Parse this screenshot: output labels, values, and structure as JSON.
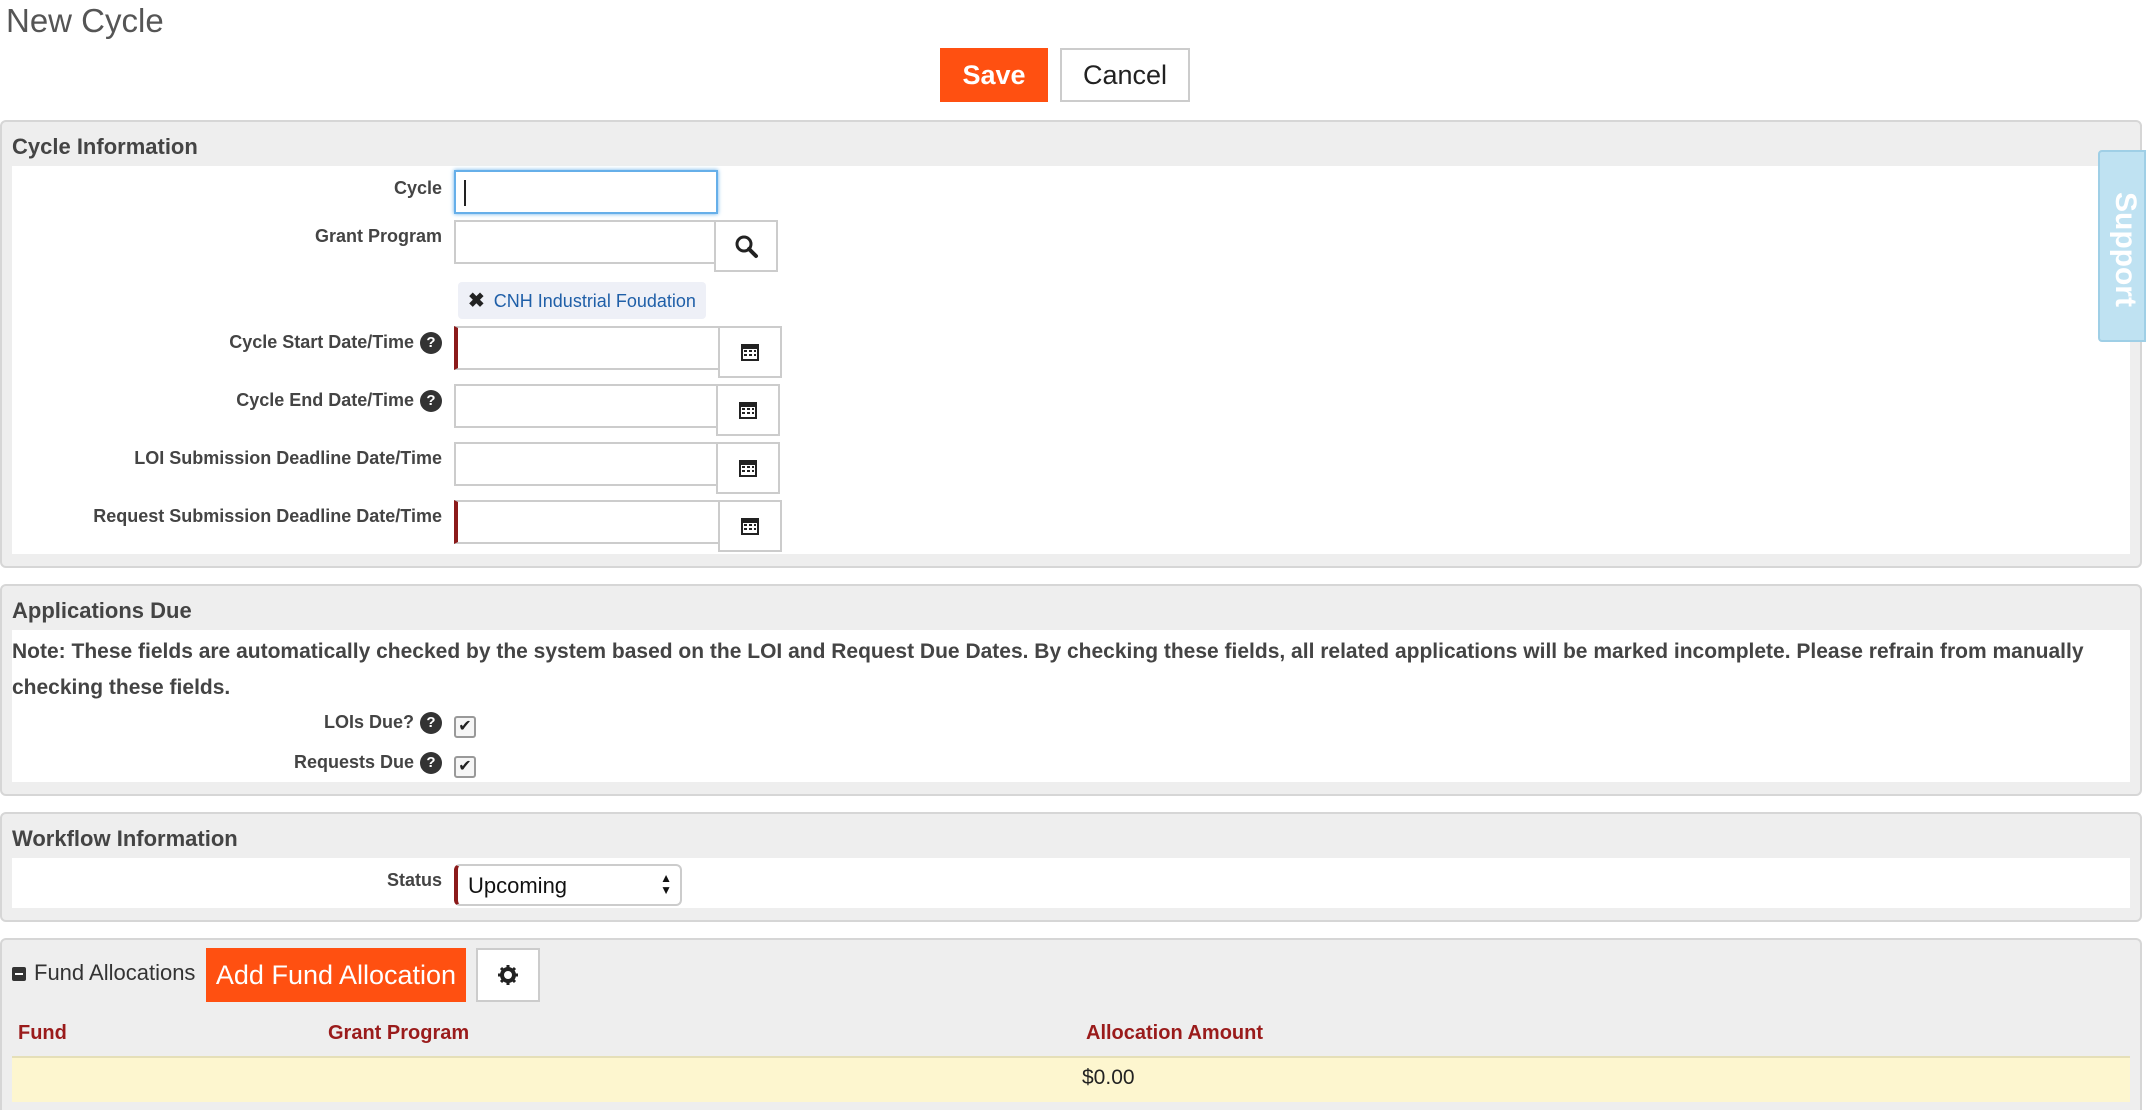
{
  "page": {
    "title": "New Cycle"
  },
  "toolbar": {
    "save_label": "Save",
    "cancel_label": "Cancel"
  },
  "support": {
    "label": "Support"
  },
  "cycle_info": {
    "title": "Cycle Information",
    "cycle_label": "Cycle",
    "cycle_value": "",
    "grant_program_label": "Grant Program",
    "grant_program_value": "",
    "grant_program_chip": "CNH Industrial Foudation",
    "start_label": "Cycle Start Date/Time",
    "end_label": "Cycle End Date/Time",
    "loi_deadline_label": "LOI Submission Deadline Date/Time",
    "request_deadline_label": "Request Submission Deadline Date/Time"
  },
  "applications_due": {
    "title": "Applications Due",
    "note": "Note: These fields are automatically checked by the system based on the LOI and Request Due Dates. By checking these fields, all related applications will be marked incomplete. Please refrain from manually checking these fields.",
    "lois_due_label": "LOIs Due?",
    "lois_due_checked": true,
    "requests_due_label": "Requests Due",
    "requests_due_checked": true
  },
  "workflow": {
    "title": "Workflow Information",
    "status_label": "Status",
    "status_value": "Upcoming"
  },
  "fund_allocations": {
    "title": "Fund Allocations",
    "add_button": "Add Fund Allocation",
    "columns": [
      "Fund",
      "Grant Program",
      "Allocation Amount"
    ],
    "rows": [
      {
        "fund": "",
        "grant_program": "",
        "allocation_amount": "$0.00"
      }
    ]
  },
  "icons": {
    "search": "search-icon",
    "calendar": "calendar-icon",
    "help": "help-icon",
    "gear": "gear-icon",
    "remove": "close-icon",
    "collapse": "minus-icon"
  },
  "colors": {
    "accent": "#ff5011",
    "required": "#8b1a1a",
    "header_text": "#9a1b1b",
    "row_highlight": "#fdf6cf"
  }
}
